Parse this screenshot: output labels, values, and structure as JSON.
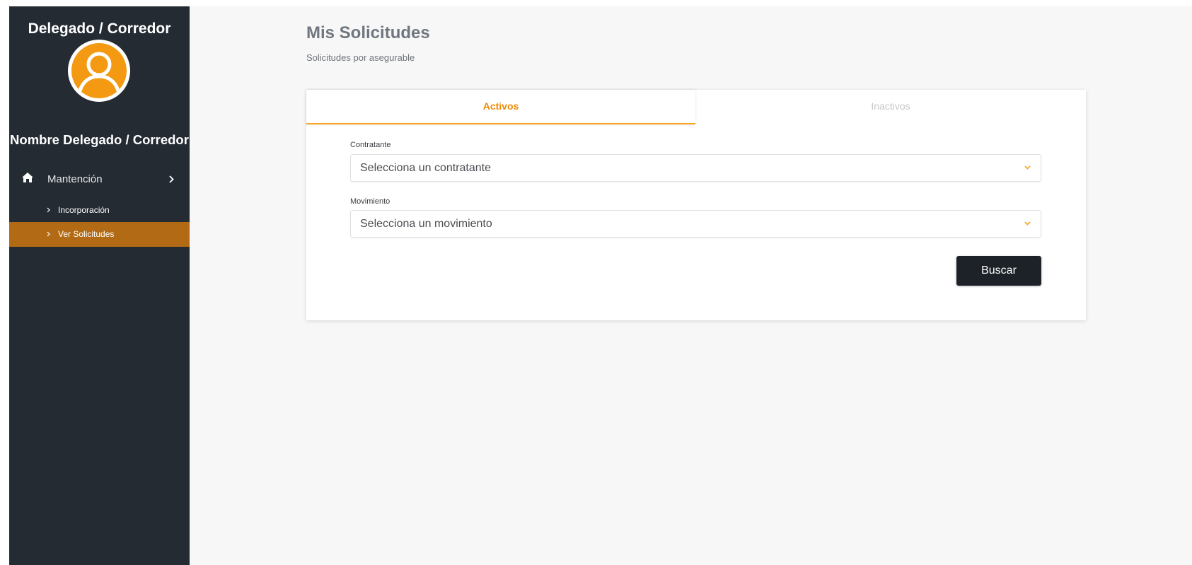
{
  "sidebar": {
    "role": "Delegado / Corredor",
    "user_name": "Nombre Delegado / Corredor",
    "menu": {
      "label": "Mantención",
      "icon": "home-icon",
      "children": [
        {
          "label": "Incorporación",
          "active": false
        },
        {
          "label": "Ver Solicitudes",
          "active": true
        }
      ]
    }
  },
  "page": {
    "title": "Mis Solicitudes",
    "subtitle": "Solicitudes por asegurable"
  },
  "tabs": [
    {
      "label": "Activos",
      "active": true
    },
    {
      "label": "Inactivos",
      "active": false
    }
  ],
  "form": {
    "contratante": {
      "label": "Contratante",
      "placeholder": "Selecciona un contratante"
    },
    "movimiento": {
      "label": "Movimiento",
      "placeholder": "Selecciona un movimiento"
    },
    "submit_label": "Buscar"
  },
  "colors": {
    "sidebar_bg": "#252b33",
    "accent": "#f5a623",
    "active_menu_bg": "#b26b14",
    "button_bg": "#1d2228"
  }
}
